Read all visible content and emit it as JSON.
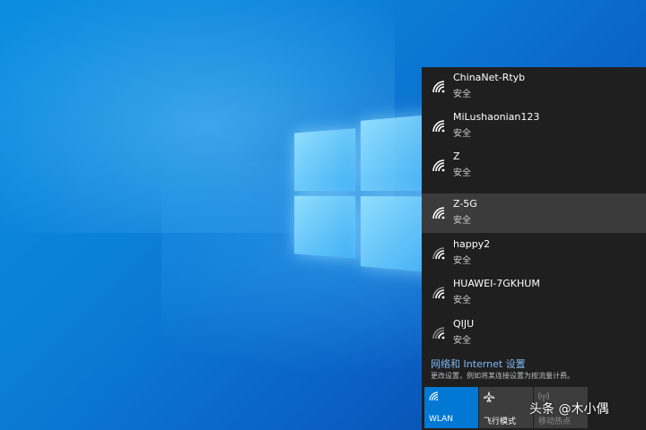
{
  "networks": [
    {
      "name": "ChinaNet-Rtyb",
      "status": "安全",
      "selected": false
    },
    {
      "name": "MiLushaonian123",
      "status": "安全",
      "selected": false
    },
    {
      "name": "Z",
      "status": "安全",
      "selected": false
    },
    {
      "name": "Z-5G",
      "status": "安全",
      "selected": true
    },
    {
      "name": "happy2",
      "status": "安全",
      "selected": false
    },
    {
      "name": "HUAWEI-7GKHUM",
      "status": "安全",
      "selected": false
    },
    {
      "name": "QIJU",
      "status": "安全",
      "selected": false
    }
  ],
  "settings": {
    "link_label": "网络和 Internet 设置",
    "description": "更改设置，例如将某连接设置为按流量计费。"
  },
  "quick_actions": {
    "wlan_label": "WLAN",
    "airplane_label": "飞行模式",
    "hotspot_label": "移动热点"
  },
  "watermark": "头条 @木小偶",
  "colors": {
    "accent": "#0078d4",
    "flyout_bg": "#1f1f1f",
    "link": "#7fb8f5"
  },
  "icons": {
    "network": "wifi-icon",
    "wlan": "wifi-icon",
    "airplane": "airplane-icon",
    "hotspot": "hotspot-icon"
  }
}
